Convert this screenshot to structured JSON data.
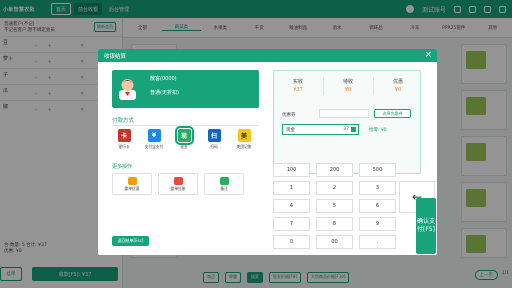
{
  "topbar": {
    "logo": "小象智慧农批",
    "tabs": [
      "首页",
      "前台收银",
      "后台管理"
    ],
    "user": "测试账号"
  },
  "left": {
    "customer": "普通客户(不记)",
    "customer_sub": "不记名客户,暂不绑定会员",
    "switch_label": "换新会员",
    "rows": [
      "豆",
      "萝卜",
      "子",
      "瓜",
      "椒"
    ],
    "summary": "合 数量: 5    合计: ¥37",
    "summary2": "优惠: ¥0",
    "btn_left": "挂单",
    "btn_checkout": "收款[F5]: ¥37"
  },
  "right": {
    "categories": [
      "全部",
      "蔬菜类",
      "水果类",
      "干货",
      "粮油制品",
      "酒水",
      "调味品",
      "冷冻",
      "PPR25管件",
      "其他"
    ],
    "active_category": 1,
    "bottom_buttons": [
      "商品",
      "称重",
      "搜索",
      "批发价格[F8]",
      "大宗商品价格[F10]"
    ],
    "prev_page": "上一页",
    "page": "1/1"
  },
  "modal": {
    "title": "收银结算",
    "close": "×",
    "member_name": "散客(0000)",
    "member_phone": "普通(无折扣)",
    "pay_section": "付款方式",
    "combo_label": "组合支付",
    "pay_methods": [
      {
        "label": "银行卡",
        "icon": "bank-card-icon",
        "color": "#c0392b",
        "glyph": "卡"
      },
      {
        "label": "支付宝支付",
        "icon": "alipay-icon",
        "color": "#1e88e5",
        "glyph": "¥"
      },
      {
        "label": "现金",
        "icon": "cash-icon",
        "color": "#27ae60",
        "glyph": "现",
        "selected": true
      },
      {
        "label": "扫码",
        "icon": "scan-icon",
        "color": "#1565c0",
        "glyph": "扫"
      },
      {
        "label": "美团记账",
        "icon": "meituan-icon",
        "color": "#f5c518",
        "glyph": "美"
      }
    ],
    "more_section": "更多操作",
    "more_ops": [
      {
        "label": "整单优惠",
        "icon": "discount-icon",
        "color": "#f39c12"
      },
      {
        "label": "整单挂账",
        "icon": "credit-icon",
        "color": "#e74c3c"
      },
      {
        "label": "备注",
        "icon": "note-icon",
        "color": "#27ae60"
      }
    ],
    "save_order": "返回结单[Esc]",
    "summary": {
      "receivable_label": "实收",
      "receivable": "¥37",
      "receivable_tag": "¥37",
      "pending_label": "待收",
      "pending": "¥0",
      "discount_label": "优惠",
      "discount": "¥0"
    },
    "coupon_label": "优惠券",
    "coupon_placeholder": "",
    "coupon_btn": "选择优惠券",
    "cash_label": "现金",
    "cash_value": "37",
    "change_label": "找零: ¥0",
    "keys": [
      "100",
      "200",
      "500",
      "1",
      "2",
      "3",
      "4",
      "5",
      "6",
      "7",
      "8",
      "9",
      "0",
      "00",
      "."
    ],
    "backspace": "←",
    "confirm": "确认支付[F5]"
  }
}
